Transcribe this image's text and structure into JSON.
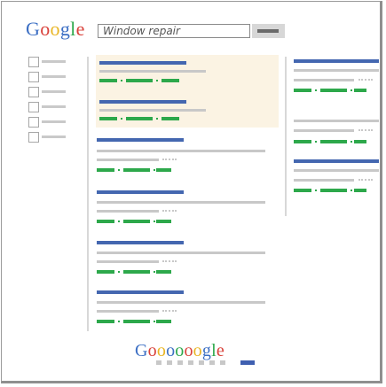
{
  "search": {
    "query": "Window repair"
  },
  "logo": {
    "letters": [
      "G",
      "o",
      "o",
      "g",
      "l",
      "e"
    ],
    "colors": [
      "#3c6fc4",
      "#d9413a",
      "#e9b524",
      "#3c6fc4",
      "#2da84b",
      "#d9413a"
    ]
  },
  "footer_logo": {
    "letters": [
      "G",
      "o",
      "o",
      "o",
      "o",
      "o",
      "o",
      "g",
      "l",
      "e"
    ],
    "colors": [
      "#3c6fc4",
      "#d9413a",
      "#e9b524",
      "#3c6fc4",
      "#2da84b",
      "#d9413a",
      "#e9b524",
      "#3c6fc4",
      "#2da84b",
      "#d9413a"
    ]
  },
  "colors": {
    "link": "#4467b0",
    "url": "#2da84b",
    "snippet": "#c8c8c8",
    "ad_background": "#fbf3e3"
  },
  "icons": {
    "search_button": "search-button-icon"
  }
}
